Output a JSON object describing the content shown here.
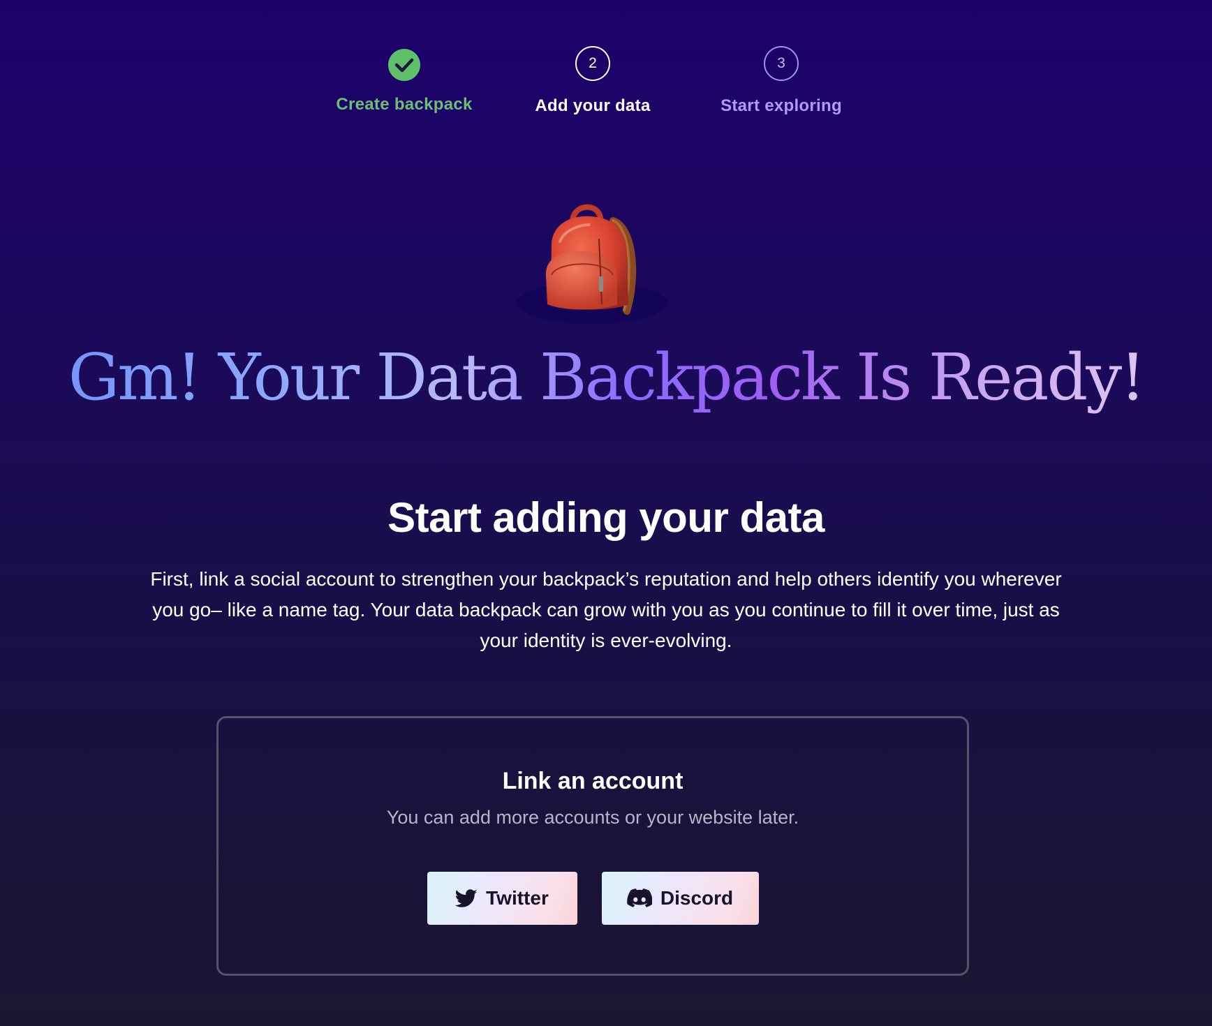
{
  "stepper": {
    "steps": [
      {
        "marker": "",
        "icon": "checkmark-icon",
        "state": "complete",
        "label": "Create backpack"
      },
      {
        "marker": "2",
        "state": "current",
        "label": "Add your data"
      },
      {
        "marker": "3",
        "state": "upcoming",
        "label": "Start exploring"
      }
    ]
  },
  "illustration": {
    "icon": "backpack-icon"
  },
  "hero": {
    "title": "Gm! Your Data Backpack Is Ready!"
  },
  "section": {
    "heading": "Start adding your data",
    "body": "First, link a social account to strengthen your backpack’s reputation and help others identify you wherever you go– like a name tag. Your data backpack can grow with you as you continue to fill it over time, just as your identity is ever-evolving."
  },
  "link_card": {
    "title": "Link an account",
    "subtitle": "You can add more accounts or your website later.",
    "buttons": [
      {
        "label": "Twitter",
        "icon": "twitter-icon"
      },
      {
        "label": "Discord",
        "icon": "discord-icon"
      }
    ]
  },
  "colors": {
    "background_top": "#1c016b",
    "background_bottom": "#1a1632",
    "step_complete": "#5fbf6a",
    "step_upcoming": "#b598ff",
    "card_border": "#56526a",
    "button_text": "#16132a"
  }
}
